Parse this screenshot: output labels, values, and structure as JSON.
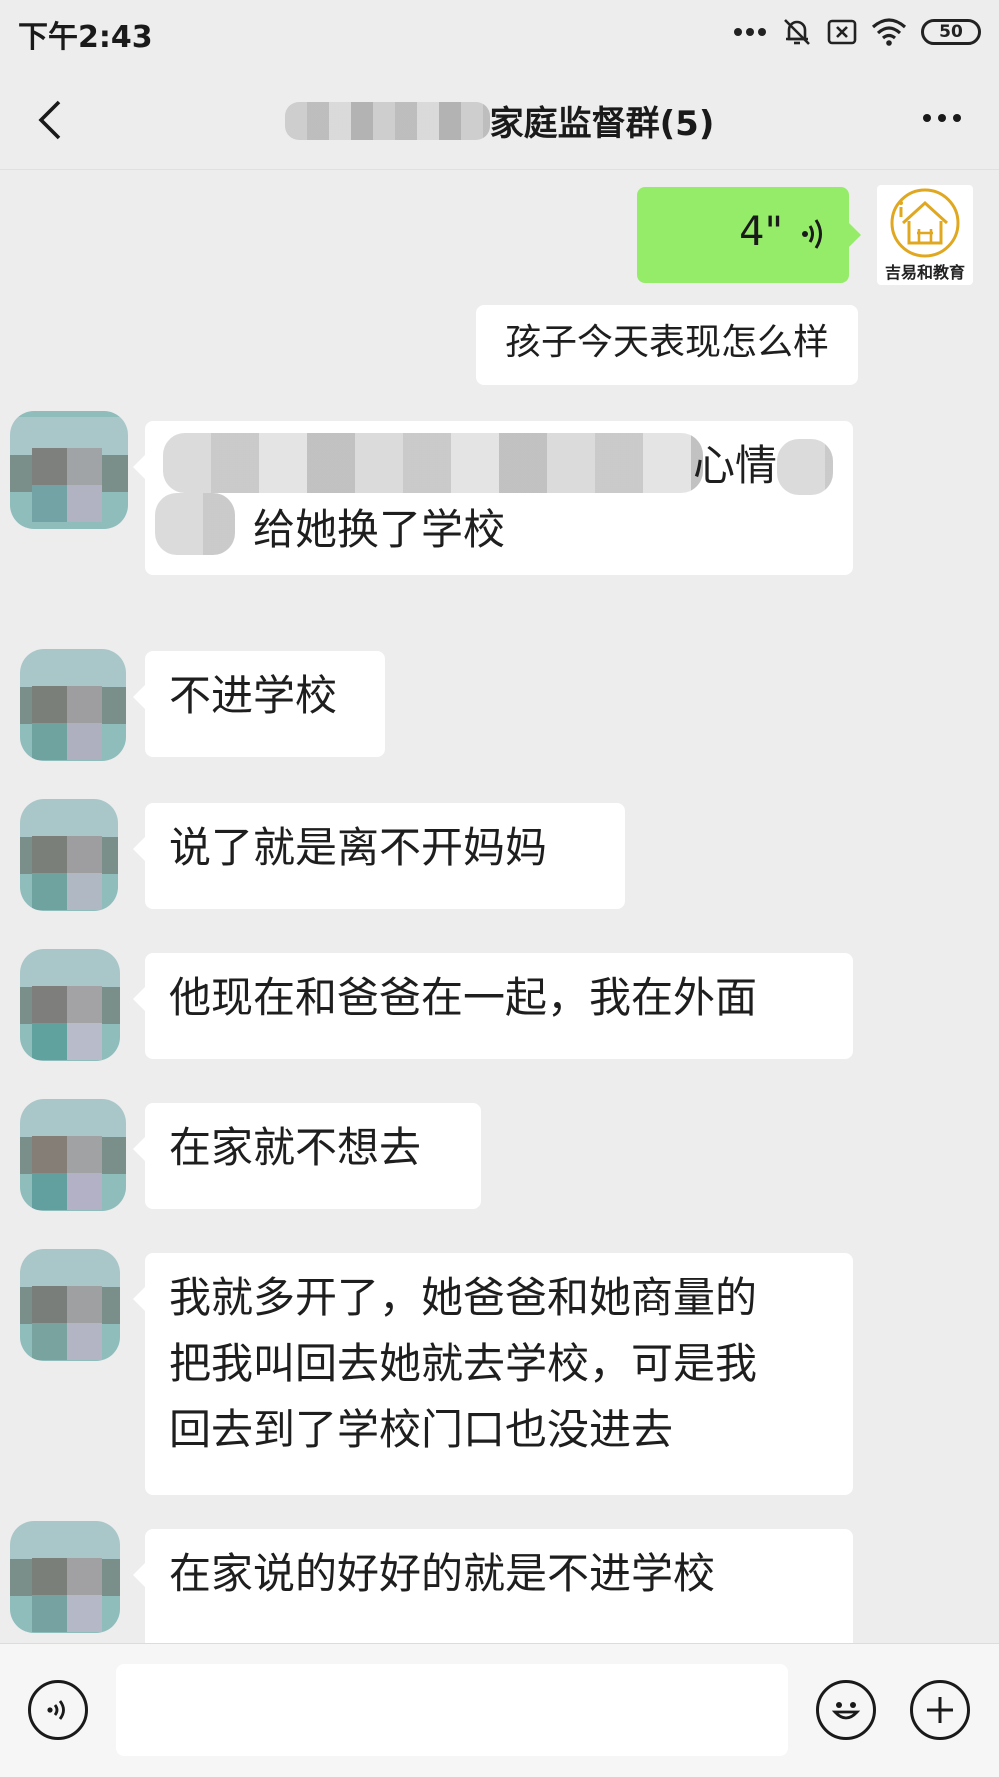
{
  "status_bar": {
    "time": "下午2:43",
    "battery": "50"
  },
  "header": {
    "title": "家庭监督群(5)"
  },
  "messages": {
    "voice": {
      "duration": "4\""
    },
    "logo": {
      "name": "吉易和教育"
    },
    "outgoing_1": "孩子今天表现怎么样",
    "incoming_1": {
      "line1_partial": "心情",
      "line2": "给她换了学校"
    },
    "incoming_2": "不进学校",
    "incoming_3": "说了就是离不开妈妈",
    "incoming_4": "他现在和爸爸在一起，我在外面",
    "incoming_5": "在家就不想去",
    "incoming_6": {
      "line1": "我就多开了，她爸爸和她商量的",
      "line2": "把我叫回去她就去学校，可是我",
      "line3": "回去到了学校门口也没进去"
    },
    "incoming_7": "在家说的好好的就是不进学校"
  },
  "icons": {
    "back": "chevron-left-icon",
    "more": "more-dots-icon",
    "mute": "bell-off-icon",
    "wifi": "wifi-icon",
    "voice_toggle": "voice-icon",
    "emoji": "smile-icon",
    "plus": "plus-icon"
  },
  "colors": {
    "background": "#ededed",
    "outgoing_bubble": "#95ec69",
    "incoming_bubble": "#ffffff"
  }
}
